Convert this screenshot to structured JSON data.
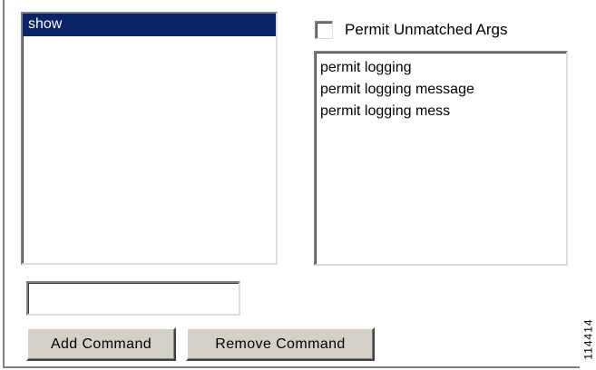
{
  "command_list": {
    "items": [
      {
        "label": "show",
        "selected": true
      }
    ]
  },
  "permit_unmatched": {
    "label": "Permit Unmatched Args",
    "checked": false
  },
  "args_list": {
    "items": [
      "permit logging",
      "permit logging message",
      "permit logging mess"
    ]
  },
  "command_input": {
    "value": "",
    "placeholder": ""
  },
  "buttons": {
    "add_label": "Add Command",
    "remove_label": "Remove Command"
  },
  "figure_id": "114414",
  "colors": {
    "selection": "#0a246a",
    "button_face": "#d4d0c8"
  }
}
